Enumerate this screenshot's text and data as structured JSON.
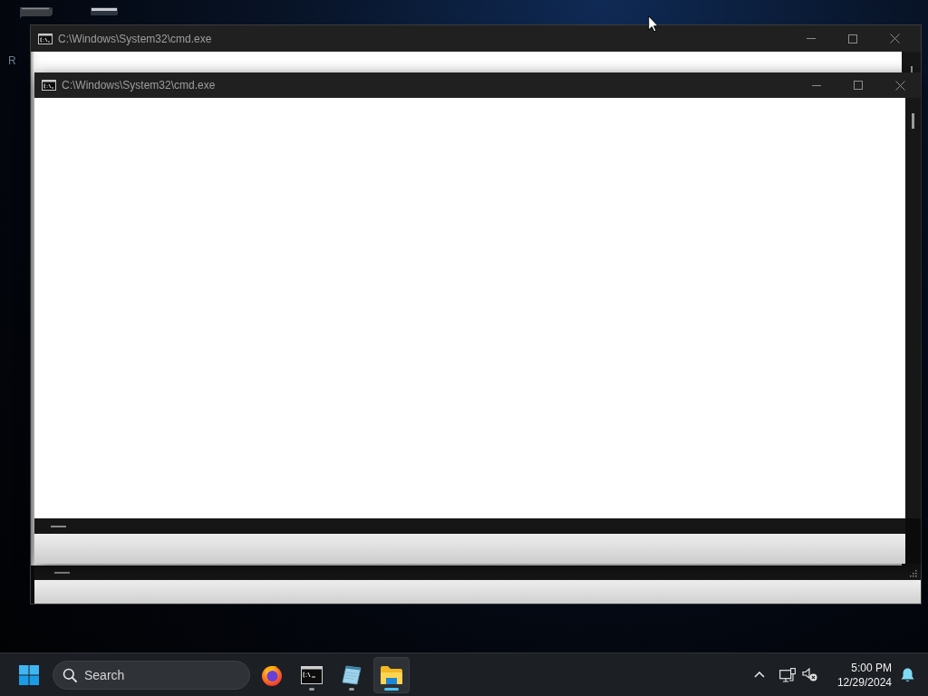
{
  "desktop": {
    "icon_labels": [
      "R"
    ]
  },
  "windows": [
    {
      "title": "C:\\Windows\\System32\\cmd.exe"
    },
    {
      "title": "C:\\Windows\\System32\\cmd.exe"
    }
  ],
  "taskbar": {
    "search": {
      "placeholder": "Search"
    },
    "apps": [
      {
        "kind": "browser",
        "selected": false,
        "running": false
      },
      {
        "kind": "terminal",
        "selected": false,
        "running": true
      },
      {
        "kind": "notepad",
        "selected": false,
        "running": true
      },
      {
        "kind": "explorer",
        "selected": true,
        "running": true
      }
    ],
    "tray": {
      "time": "5:00 PM",
      "date": "12/29/2024"
    }
  }
}
